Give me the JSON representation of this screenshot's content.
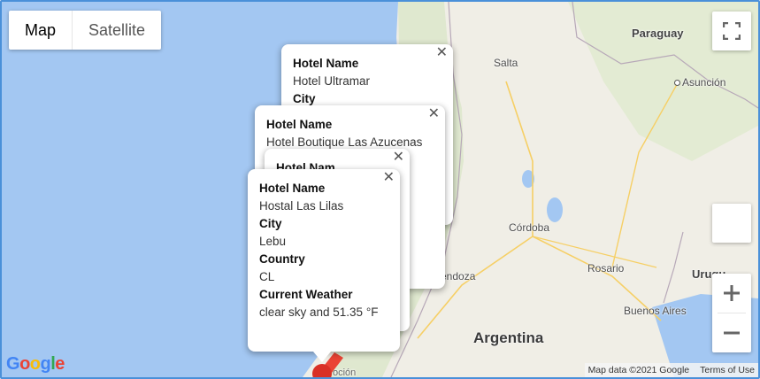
{
  "map_type": {
    "map_label": "Map",
    "satellite_label": "Satellite"
  },
  "places": {
    "paraguay": "Paraguay",
    "salta": "Salta",
    "asuncion": "Asunción",
    "cordoba": "Córdoba",
    "rosario": "Rosario",
    "uruguay": "Urugu",
    "buenos_aires": "Buenos Aires",
    "argentina": "Argentina",
    "mendoza": "endoza",
    "concepcion": "oción"
  },
  "attribution": {
    "map_data": "Map data ©2021 Google",
    "terms": "Terms of Use"
  },
  "logo_text": "Google",
  "info_windows": [
    {
      "hotel_name_label": "Hotel Name",
      "hotel_name": "Hotel Ultramar",
      "city_label": "City"
    },
    {
      "hotel_name_label": "Hotel Name",
      "hotel_name": "Hotel Boutique Las Azucenas"
    },
    {
      "hotel_name_label": "Hotel Nam"
    },
    {
      "hotel_name_label": "Hotel Name",
      "hotel_name": "Hostal Las Lilas",
      "city_label": "City",
      "city": "Lebu",
      "country_label": "Country",
      "country": "CL",
      "weather_label": "Current Weather",
      "weather": "clear sky and 51.35 °F"
    }
  ],
  "icons": [
    "fullscreen-icon",
    "pegman-icon",
    "zoom-in-icon",
    "zoom-out-icon",
    "close-icon",
    "map-marker-icon"
  ],
  "colors": {
    "water": "#a3c7f2",
    "land": "#f0eee6",
    "marker": "#ea4335"
  }
}
